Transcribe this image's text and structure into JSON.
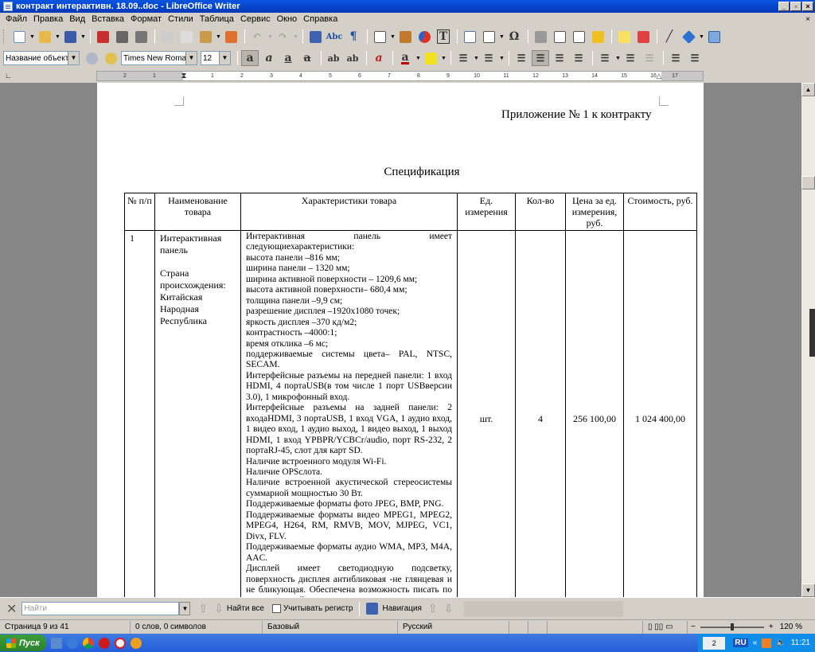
{
  "window": {
    "title": "контракт интерактивн. 18.09..doc - LibreOffice Writer",
    "min_label": "_",
    "max_label": "▫",
    "close_label": "×"
  },
  "menu": {
    "items": [
      "Файл",
      "Правка",
      "Вид",
      "Вставка",
      "Формат",
      "Стили",
      "Таблица",
      "Сервис",
      "Окно",
      "Справка"
    ],
    "close_doc": "×"
  },
  "formatting": {
    "style_name": "Название объекта",
    "font_name": "Times New Roman",
    "font_size": "12"
  },
  "ruler": {
    "marks": [
      "2",
      "1",
      "1",
      "2",
      "3",
      "4",
      "5",
      "6",
      "7",
      "8",
      "9",
      "10",
      "11",
      "12",
      "13",
      "14",
      "15",
      "16",
      "17"
    ]
  },
  "document": {
    "appendix_title": "Приложение № 1  к контракту",
    "spec_title": "Спецификация",
    "table": {
      "headers": [
        "№ п/п",
        "Наименование товара",
        "Характеристики товара",
        "Ед. измерения",
        "Кол-во",
        "Цена за ед. измерения, руб.",
        "Стоимость, руб."
      ],
      "row": {
        "num": "1",
        "name": "Интерактивная панель",
        "origin": "Страна происхождения: Китайская Народная Республика",
        "unit": "шт.",
        "qty": "4",
        "price": "256 100,00",
        "total": "1 024 400,00",
        "characteristics": [
          "Интерактивная панель имеет следующиехарактеристики:",
          "высота панели –816 мм;",
          "ширина панели – 1320 мм;",
          "ширина активной поверхности – 1209,6 мм;",
          "высота активной поверхности– 680,4 мм;",
          "толщина панели –9,9 см;",
          "разрешение дисплея –1920х1080 точек;",
          "яркость дисплея –370 кд/м2;",
          "контрастность –4000:1;",
          "время отклика –6 мс;",
          "поддерживаемые системы цвета– PAL, NTSC, SECAM.",
          "Интерфейсные разъемы на передней панели: 1 вход HDMI, 4 портаUSB(в том числе 1 порт USBверсии 3.0), 1 микрофонный вход.",
          "Интерфейсные разъемы на задней панели: 2 входаHDMI, 3 портаUSB, 1 вход VGA, 1 аудио вход, 1 видео вход, 1 аудио выход, 1 видео выход, 1 выход HDMI, 1 вход YPBPR/YCBCr/audio, порт RS-232, 2 портаRJ-45, слот для карт SD.",
          "Наличие встроенного модуля Wi-Fi.",
          "Наличие OPSслота.",
          "Наличие встроенной акустической стереосистемы суммарной мощностью 30 Вт.",
          "Поддерживаемые форматы фото JPEG, BMP, PNG.",
          "Поддерживаемые форматы видео MPEG1, MPEG2, MPEG4, H264, RM, RMVB, MOV, MJPEG, VC1, Divx, FLV.",
          "Поддерживаемые форматы аудио WMA, MP3, M4A, AAC.",
          "Дисплей имеет светодиодную подсветку, поверхность дисплея антибликовая -не глянцевая и не бликующая. Обеспечена возможность писать по интерактивной панели и управлять приложениями"
        ]
      }
    }
  },
  "findbar": {
    "placeholder": "Найти",
    "find_all": "Найти все",
    "match_case": "Учитывать регистр",
    "navigation": "Навигация"
  },
  "status": {
    "page": "Страница 9 из 41",
    "words": "0 слов, 0 символов",
    "page_style": "Базовый",
    "language": "Русский",
    "zoom": "120 %"
  },
  "taskbar": {
    "start": "Пуск",
    "tray_box": "2",
    "lang": "RU",
    "chevrons": "«",
    "time": "11:21"
  }
}
